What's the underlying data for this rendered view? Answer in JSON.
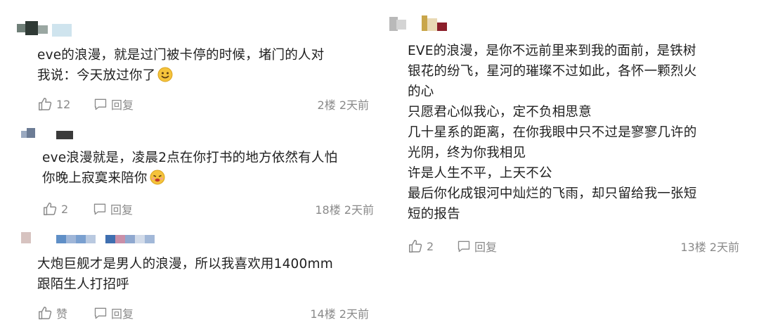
{
  "comments": [
    {
      "text_lines": [
        "eve的浪漫，就是过门被卡停的时候，堵门的人对",
        "我说：今天放过你了"
      ],
      "emoji": "smile-emoji",
      "likes": "12",
      "reply_label": "回复",
      "meta": "2楼 2天前"
    },
    {
      "text_lines": [
        "eve浪漫就是，凌晨2点在你打书的地方依然有人怕",
        "你晚上寂寞来陪你"
      ],
      "emoji": "face-emoji",
      "likes": "2",
      "reply_label": "回复",
      "meta": "18楼 2天前"
    },
    {
      "text_lines": [
        "大炮巨舰才是男人的浪漫，所以我喜欢用1400mm",
        "跟陌生人打招呼"
      ],
      "likes": "赞",
      "reply_label": "回复",
      "meta": "14楼 2天前"
    },
    {
      "text_lines": [
        "EVE的浪漫，是你不远前里来到我的面前，是铁树",
        "银花的纷飞，星河的璀璨不过如此，各怀一颗烈火",
        "的心",
        "只愿君心似我心，定不负相思意",
        "几十星系的距离，在你我眼中只不过是寥寥几许的",
        "光阴，终为你我相见",
        "许是人生不平，上天不公",
        "最后你化成银河中灿烂的飞雨，却只留给我一张短",
        "短的报告"
      ],
      "likes": "2",
      "reply_label": "回复",
      "meta": "13楼 2天前"
    }
  ],
  "colors": {
    "text": "#1f1f1f",
    "meta": "#8a8a8a",
    "emoji_fill": "#f5c33b"
  }
}
